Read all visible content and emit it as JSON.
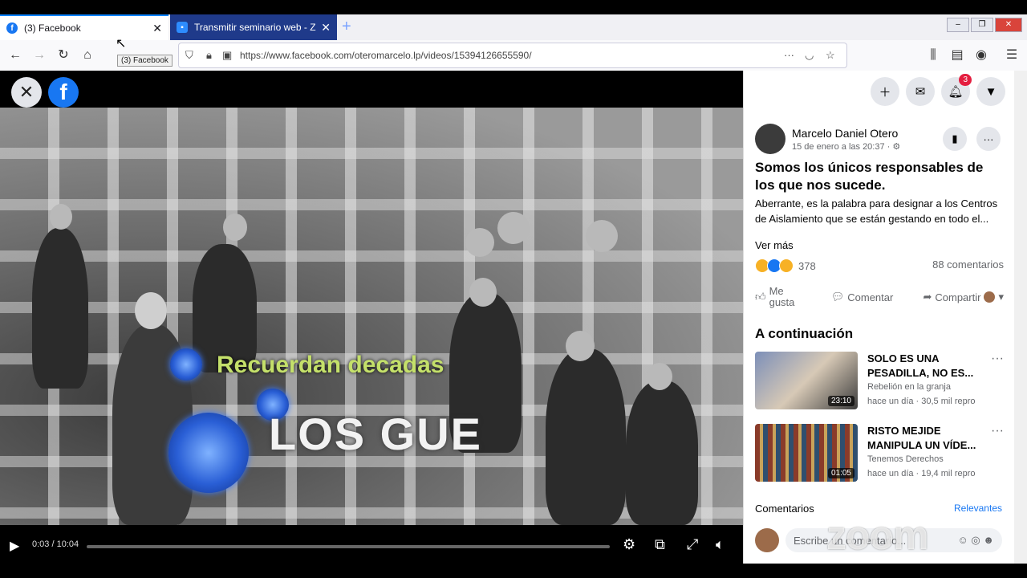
{
  "browser": {
    "tabs": [
      {
        "title": "(3) Facebook",
        "active": true
      },
      {
        "title": "Transmitir seminario web - Zo",
        "active": false
      }
    ],
    "tooltip": "(3) Facebook",
    "url": "https://www.facebook.com/oteromarcelo.lp/videos/15394126655590/"
  },
  "video": {
    "caption_top": "Recuerdan decadas",
    "caption_main": "LOS GUE",
    "time": "0:03 / 10:04",
    "progress": 0
  },
  "header_icons": {
    "notifications_badge": "3"
  },
  "post": {
    "author": "Marcelo Daniel Otero",
    "date": "15 de enero a las 20:37 · ⚙",
    "title": "Somos los únicos responsables de los que nos sucede.",
    "body": "Aberrante, es la palabra para designar a los Centros de Aislamiento que se están gestando en todo el...",
    "see_more": "Ver más",
    "reaction_count": "378",
    "comment_count": "88 comentarios",
    "like_label": "Me gusta",
    "comment_label": "Comentar",
    "share_label": "Compartir"
  },
  "up_next": {
    "heading": "A continuación",
    "items": [
      {
        "title": "SOLO ES UNA PESADILLA, NO ES...",
        "source": "Rebelión en la granja",
        "meta": "hace un día · 30,5 mil repro",
        "duration": "23:10"
      },
      {
        "title": "RISTO MEJIDE MANIPULA UN VÍDE...",
        "source": "Tenemos Derechos",
        "meta": "hace un día · 19,4 mil repro",
        "duration": "01:05"
      }
    ]
  },
  "comments": {
    "heading": "Comentarios",
    "filter": "Relevantes",
    "placeholder": "Escribe un comentario..."
  },
  "watermark": "zoom"
}
